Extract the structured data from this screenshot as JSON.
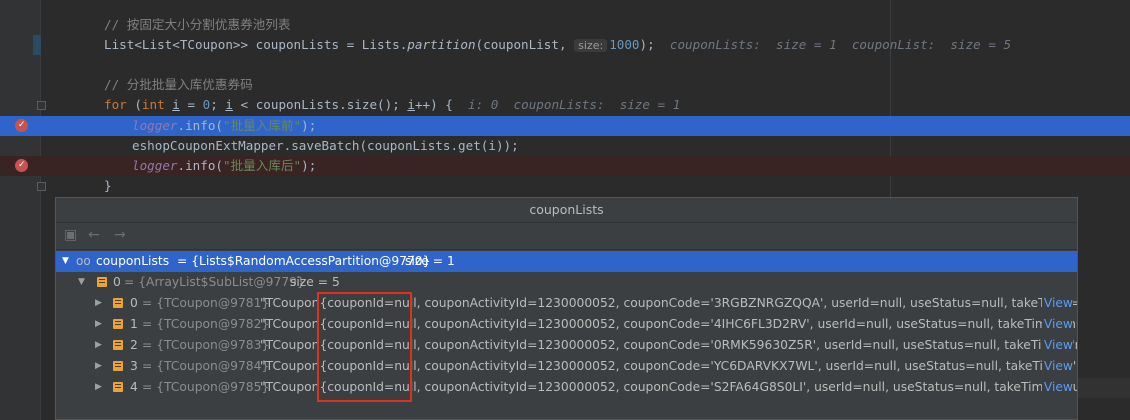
{
  "code": {
    "comment1": "// 按固定大小分割优惠券池列表",
    "line_partition": {
      "type_text": "List<List<TCoupon>> couponLists = Lists.",
      "method": "partition",
      "args_open": "(couponList,",
      "hint": "size:",
      "number": "1000",
      "close": ");",
      "inline": "couponLists:  size = 1  couponList:  size = 5"
    },
    "comment2": "// 分批批量入库优惠券码",
    "line_for": {
      "kw_for": "for",
      "open": " (",
      "kw_int": "int",
      "var_i": "i",
      "eq": " = ",
      "zero": "0",
      "semi": "; ",
      "cond": " < couponLists.size(); ",
      "incr": "++) {",
      "inline": "i: 0  couponLists:  size = 1"
    },
    "line_logger1": {
      "field": "logger",
      "call": ".info(",
      "str": "\"批量入库前\"",
      "end": ");"
    },
    "line_save": {
      "text": "eshopCouponExtMapper.saveBatch(couponLists.get(i));"
    },
    "line_logger2": {
      "field": "logger",
      "call": ".info(",
      "str": "\"批量入库后\"",
      "end": ");"
    },
    "line_brace": "}"
  },
  "popup": {
    "title": "couponLists",
    "toolbar": {
      "icons": [
        "copy-icon",
        "back-arrow-icon",
        "forward-arrow-icon"
      ],
      "back": "←",
      "forward": "→"
    },
    "root": {
      "name": "couponLists",
      "value": "= {Lists$RandomAccessPartition@9770}",
      "size": "size = 1"
    },
    "child": {
      "index": "0",
      "value": "= {ArrayList$SubList@9779}",
      "size": "size = 5"
    },
    "items": [
      {
        "index": "0",
        "ref": "= {TCoupon@9781}",
        "text": "\"TCoupon{couponId=null, couponActivityId=1230000052, couponCode='3RGBZNRGZQQA', userId=null, useStatus=null, takeTime='n...",
        "view": "View"
      },
      {
        "index": "1",
        "ref": "= {TCoupon@9782}",
        "text": "\"TCoupon{couponId=null, couponActivityId=1230000052, couponCode='4IHC6FL3D2RV', userId=null, useStatus=null, takeTime='null'...",
        "view": "View"
      },
      {
        "index": "2",
        "ref": "= {TCoupon@9783}",
        "text": "\"TCoupon{couponId=null, couponActivityId=1230000052, couponCode='0RMK59630Z5R', userId=null, useStatus=null, takeTime='nu...",
        "view": "View"
      },
      {
        "index": "3",
        "ref": "= {TCoupon@9784}",
        "text": "\"TCoupon{couponId=null, couponActivityId=1230000052, couponCode='YC6DARVKX7WL', userId=null, useStatus=null, takeTime='nu...",
        "view": "View"
      },
      {
        "index": "4",
        "ref": "= {TCoupon@9785}",
        "text": "\"TCoupon{couponId=null, couponActivityId=1230000052, couponCode='S2FA64G8S0LI', userId=null, useStatus=null, takeTime='null',...",
        "view": "View"
      }
    ]
  },
  "colors": {
    "breakpoint": "#c75450",
    "selection": "#2f65ca",
    "annotation_box": "#e0301e",
    "link": "#589df6"
  }
}
